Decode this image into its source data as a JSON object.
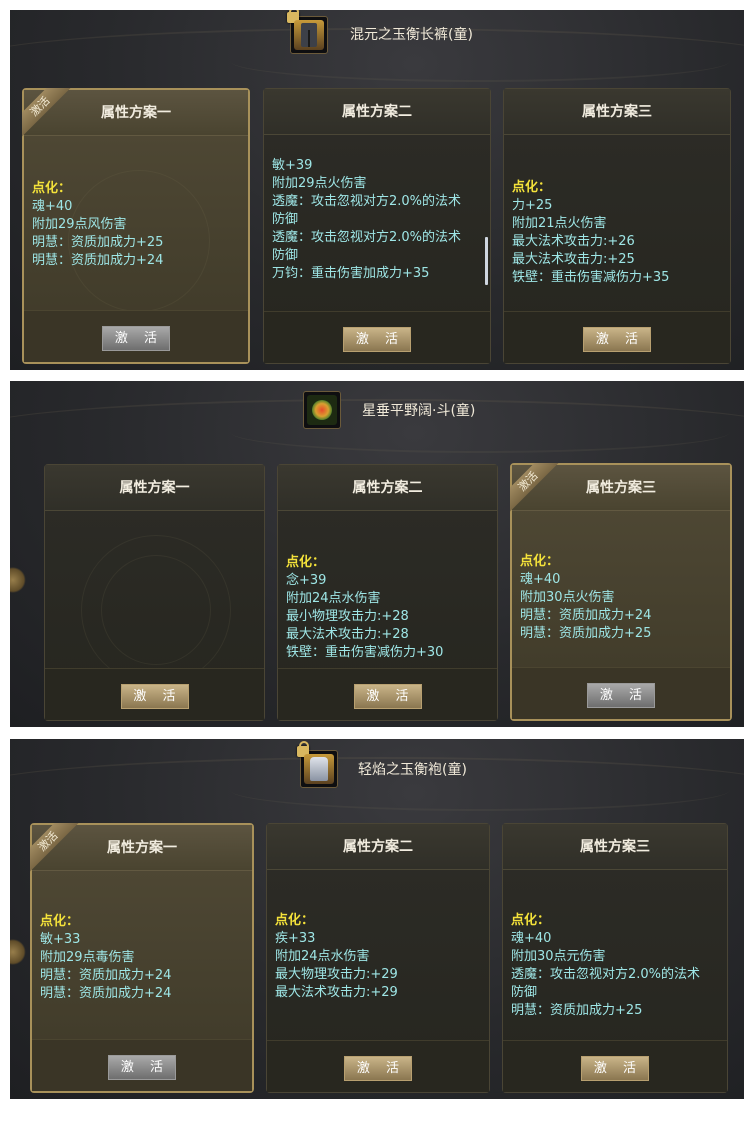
{
  "panels": [
    {
      "item_title": "混元之玉衡长裤(童)",
      "item_icon": "pants-icon",
      "active_badge": "激活",
      "cards": [
        {
          "header": "属性方案一",
          "button": "激 活",
          "lines": [
            "点化：",
            "魂+40",
            "附加29点风伤害",
            "明慧：资质加成力+25",
            "明慧：资质加成力+24"
          ]
        },
        {
          "header": "属性方案二",
          "button": "激 活",
          "lines": [
            "敏+39",
            "附加29点火伤害",
            "透魔：攻击忽视对方2.0%的法术",
            "防御",
            "透魔：攻击忽视对方2.0%的法术",
            "防御",
            "万钧：重击伤害加成力+35"
          ]
        },
        {
          "header": "属性方案三",
          "button": "激 活",
          "lines": [
            "点化：",
            "力+25",
            "附加21点火伤害",
            "最大法术攻击力:+26",
            "最大法术攻击力:+25",
            "铁壁：重击伤害减伤力+35"
          ]
        }
      ]
    },
    {
      "item_title": "星垂平野阔·斗(童)",
      "item_icon": "amulet-icon",
      "active_badge": "激活",
      "cards": [
        {
          "header": "属性方案一",
          "button": "激 活",
          "lines": []
        },
        {
          "header": "属性方案二",
          "button": "激 活",
          "lines": [
            "点化：",
            "念+39",
            "附加24点水伤害",
            "最小物理攻击力:+28",
            "最大法术攻击力:+28",
            "铁壁：重击伤害减伤力+30"
          ]
        },
        {
          "header": "属性方案三",
          "button": "激 活",
          "lines": [
            "点化：",
            "魂+40",
            "附加30点火伤害",
            "明慧：资质加成力+24",
            "明慧：资质加成力+25"
          ]
        }
      ]
    },
    {
      "item_title": "轻焰之玉衡袍(童)",
      "item_icon": "robe-icon",
      "active_badge": "激活",
      "cards": [
        {
          "header": "属性方案一",
          "button": "激 活",
          "lines": [
            "点化：",
            "敏+33",
            "附加29点毒伤害",
            "明慧：资质加成力+24",
            "明慧：资质加成力+24"
          ]
        },
        {
          "header": "属性方案二",
          "button": "激 活",
          "lines": [
            "点化：",
            "疾+33",
            "附加24点水伤害",
            "最大物理攻击力:+29",
            "最大法术攻击力:+29"
          ]
        },
        {
          "header": "属性方案三",
          "button": "激 活",
          "lines": [
            "点化：",
            "魂+40",
            "附加30点元伤害",
            "透魔：攻击忽视对方2.0%的法术",
            "防御",
            "明慧：资质加成力+25"
          ]
        }
      ]
    }
  ]
}
